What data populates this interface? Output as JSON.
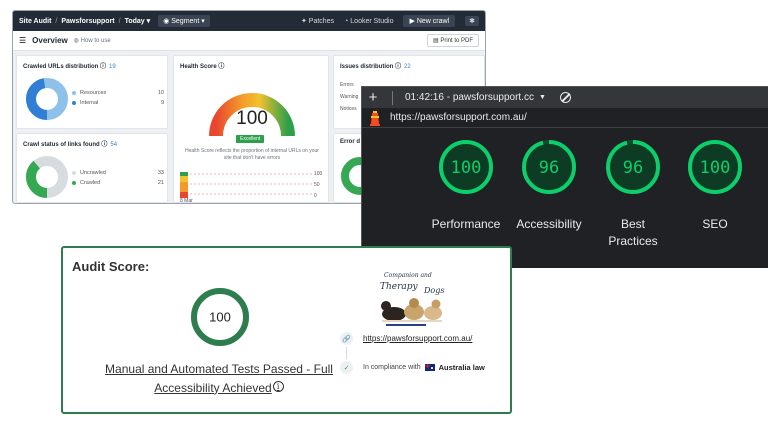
{
  "site_audit": {
    "breadcrumb": [
      "Site Audit",
      "Pawsforsupport",
      "Today"
    ],
    "segment_label": "Segment",
    "patches_label": "Patches",
    "looker_label": "Looker Studio",
    "new_crawl_label": "New crawl",
    "page_title": "Overview",
    "how_to_use": "How to use",
    "print_label": "Print to PDF",
    "crawled": {
      "title": "Crawled URLs distribution",
      "count": "19",
      "legend": [
        {
          "label": "Resources",
          "value": "10",
          "color": "#8ec1ea"
        },
        {
          "label": "Internal",
          "value": "9",
          "color": "#2f7fd5"
        }
      ]
    },
    "health": {
      "title": "Health Score",
      "score": "100",
      "badge": "Excellent",
      "description": "Health Score reflects the proportion of internal URLs on your site that don't have errors",
      "axis_top": "100",
      "axis_mid": "50",
      "axis_bottom": "0",
      "date_label": "8 Mar"
    },
    "issues": {
      "title": "Issues distribution",
      "count": "22",
      "rows": [
        "Errors",
        "Warning",
        "Notices"
      ]
    },
    "status": {
      "title": "Crawl status of links found",
      "count": "54",
      "legend": [
        {
          "label": "Uncrawled",
          "value": "33",
          "color": "#d8dce0"
        },
        {
          "label": "Crawled",
          "value": "21",
          "color": "#34a853"
        }
      ]
    },
    "error_title": "Error d"
  },
  "lighthouse": {
    "tab_time": "01:42:16 - pawsforsupport.cc",
    "url": "https://pawsforsupport.com.au/",
    "accent": "#0cce6b",
    "gauges": [
      {
        "label": "Performance",
        "score": 100
      },
      {
        "label": "Accessibility",
        "score": 96
      },
      {
        "label": "Best Practices",
        "score": 96
      },
      {
        "label": "SEO",
        "score": 100
      }
    ]
  },
  "audit": {
    "title": "Audit Score:",
    "score": 100,
    "score_text": "100",
    "message_line1": "Manual and Automated Tests Passed - Full",
    "message_line2": "Accessibility Achieved",
    "link": "https://pawsforsupport.com.au/",
    "compliance_prefix": "In compliance with",
    "compliance_law": "Australia law",
    "logo_top": "Companion and",
    "logo_mid": "Therapy",
    "logo_dogs": "Dogs"
  }
}
